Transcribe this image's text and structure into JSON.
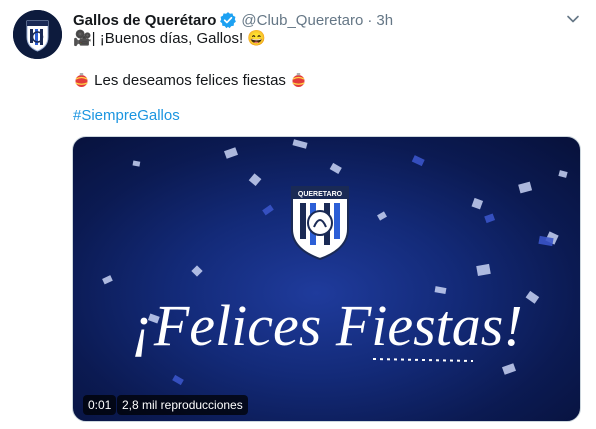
{
  "tweet": {
    "display_name": "Gallos de Querétaro",
    "handle": "@Club_Queretaro",
    "separator": "·",
    "time": "3h",
    "line1": "🎥| ¡Buenos días, Gallos! 😄",
    "line2": "Les deseamos felices fiestas",
    "hashtag": "#SiempreGallos"
  },
  "media": {
    "crest_text": "QUERETARO",
    "headline": "¡Felices Fiestas!",
    "video_time": "0:01",
    "views": "2,8 mil reproducciones"
  },
  "colors": {
    "accent": "#1b95e0",
    "verified": "#1da1f2",
    "muted": "#657786",
    "media_bg": "#132a78"
  },
  "icons": {
    "verified": "verified-badge-icon",
    "caret": "chevron-down-icon",
    "ornament": "christmas-ornament-emoji"
  }
}
